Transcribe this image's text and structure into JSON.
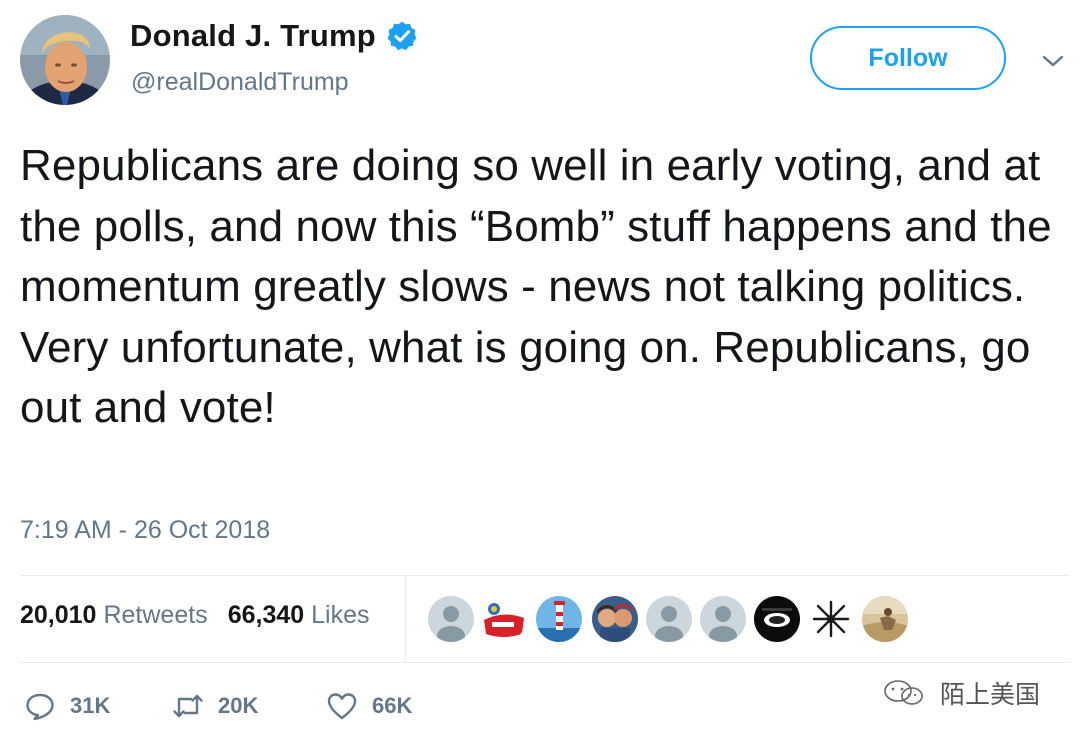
{
  "header": {
    "display_name": "Donald J. Trump",
    "handle": "@realDonaldTrump",
    "verified_icon": "verified-badge-icon",
    "follow_label": "Follow",
    "menu_icon": "chevron-down-icon"
  },
  "tweet": {
    "text": "Republicans are doing so well in early voting, and at the polls, and now this “Bomb” stuff happens and the momentum greatly slows - news not talking politics. Very unfortunate, what is going on. Republicans, go out and vote!",
    "timestamp": "7:19 AM - 26 Oct 2018"
  },
  "stats": {
    "retweets_count": "20,010",
    "retweets_label": "Retweets",
    "likes_count": "66,340",
    "likes_label": "Likes"
  },
  "likers": [
    {
      "icon": "default-avatar-icon"
    },
    {
      "icon": "red-hat-avatar-icon"
    },
    {
      "icon": "lighthouse-avatar-icon"
    },
    {
      "icon": "couple-photo-avatar-icon"
    },
    {
      "icon": "default-avatar-icon"
    },
    {
      "icon": "default-avatar-icon"
    },
    {
      "icon": "dark-photo-avatar-icon"
    },
    {
      "icon": "sketch-avatar-icon"
    },
    {
      "icon": "desert-photo-avatar-icon"
    }
  ],
  "actions": {
    "reply_count": "31K",
    "retweet_count": "20K",
    "like_count": "66K"
  },
  "watermark": {
    "text": "陌上美国"
  },
  "colors": {
    "accent": "#1da1f2",
    "text_primary": "#14171a",
    "text_secondary": "#657786",
    "divider": "#e6ecf0"
  }
}
